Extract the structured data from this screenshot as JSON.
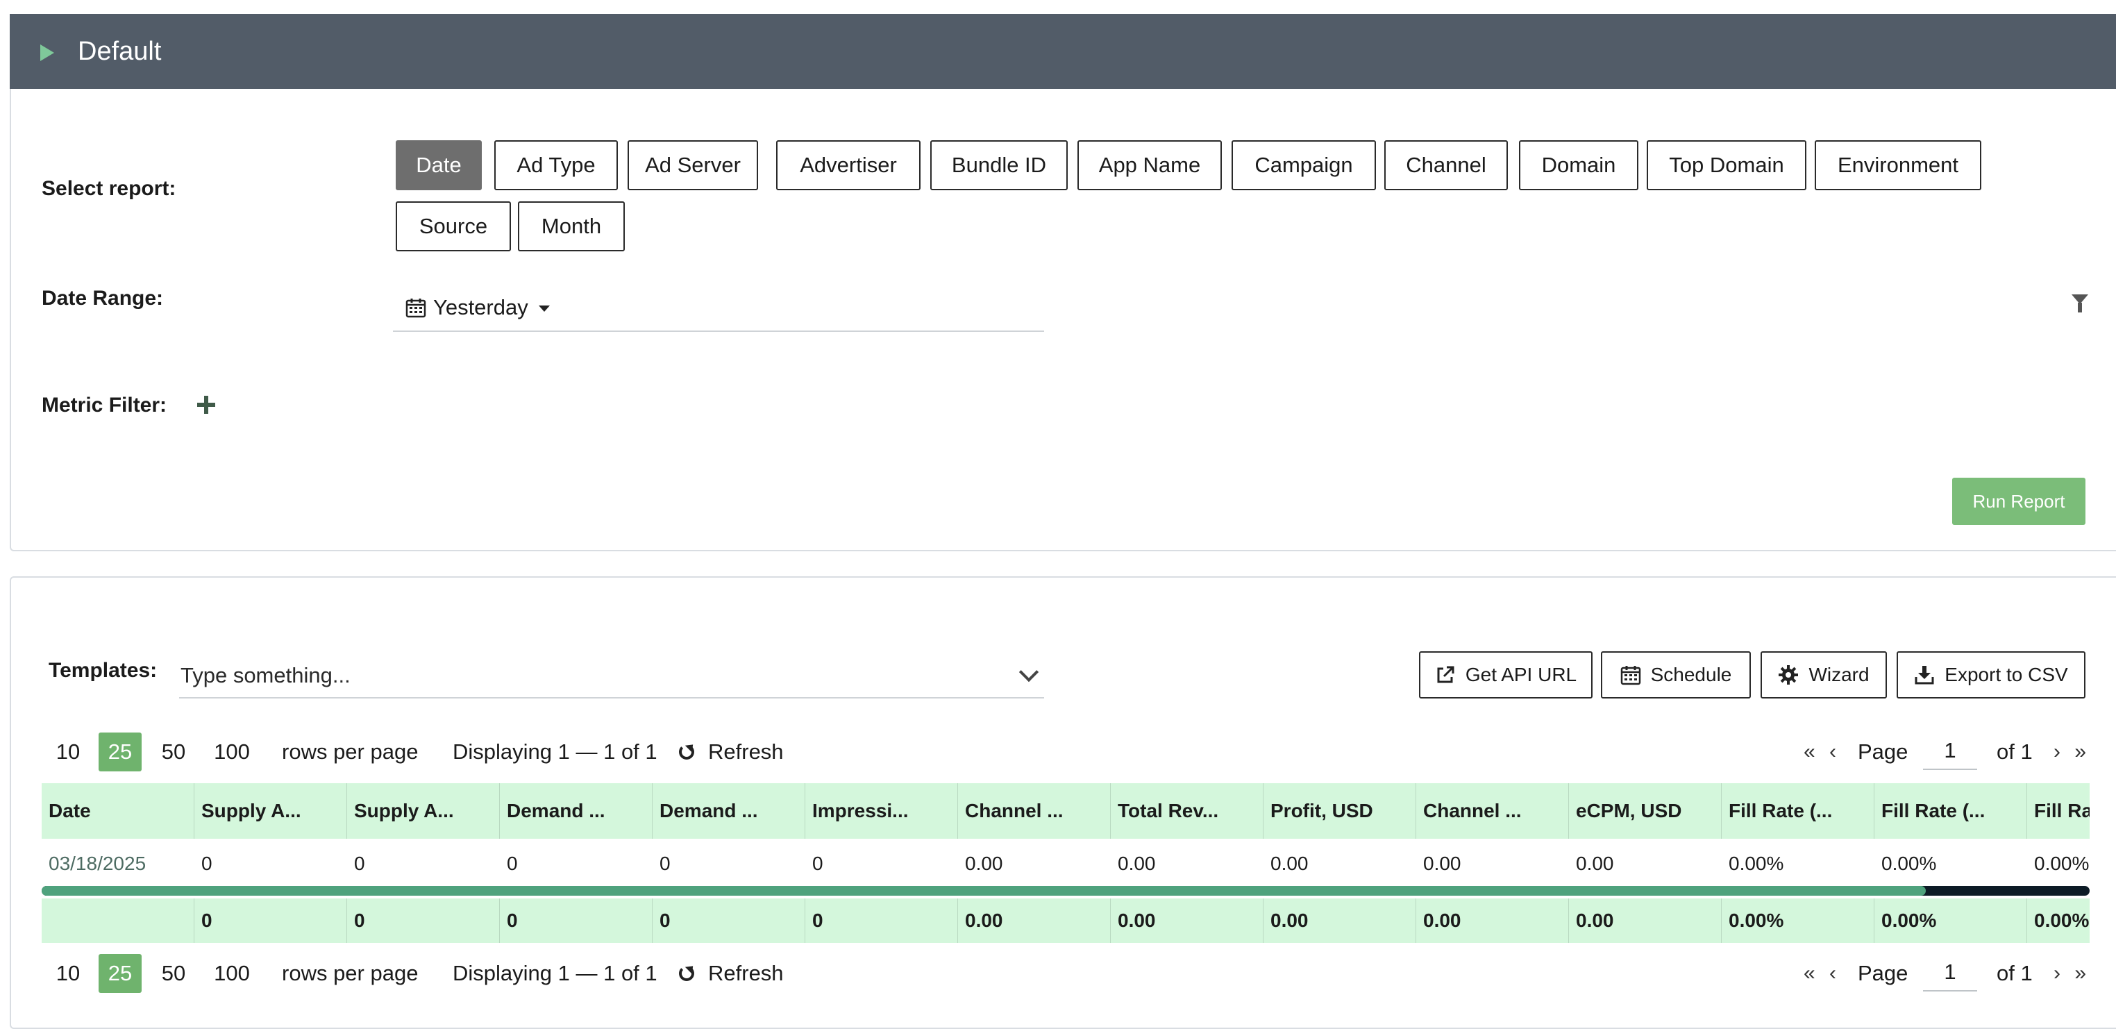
{
  "header": {
    "title": "Default"
  },
  "report": {
    "select_label": "Select report:",
    "buttons": [
      "Date",
      "Ad Type",
      "Ad Server",
      "Advertiser",
      "Bundle ID",
      "App Name",
      "Campaign",
      "Channel",
      "Domain",
      "Top Domain",
      "Environment",
      "Source",
      "Month"
    ],
    "active": "Date"
  },
  "date_range": {
    "label": "Date Range:",
    "value": "Yesterday"
  },
  "metric_filter": {
    "label": "Metric Filter:"
  },
  "run_button": "Run Report",
  "templates": {
    "label": "Templates:",
    "placeholder": "Type something..."
  },
  "actions": {
    "api": "Get API URL",
    "schedule": "Schedule",
    "wizard": "Wizard",
    "export": "Export to CSV"
  },
  "pager": {
    "sizes": [
      "10",
      "25",
      "50",
      "100"
    ],
    "active_size": "25",
    "rows_per_page": "rows per page",
    "displaying": "Displaying 1 — 1 of 1",
    "refresh": "Refresh",
    "first_prev": "« ‹",
    "page_label": "Page",
    "page_value": "1",
    "of_label": "of 1",
    "next_last": "› »"
  },
  "table": {
    "columns": [
      "Date",
      "Supply A...",
      "Supply A...",
      "Demand ...",
      "Demand ...",
      "Impressi...",
      "Channel ...",
      "Total Rev...",
      "Profit, USD",
      "Channel ...",
      "eCPM, USD",
      "Fill Rate (...",
      "Fill Rate (...",
      "Fill Ra"
    ],
    "rows": [
      [
        "03/18/2025",
        "0",
        "0",
        "0",
        "0",
        "0",
        "0.00",
        "0.00",
        "0.00",
        "0.00",
        "0.00",
        "0.00%",
        "0.00%",
        "0.00%"
      ]
    ],
    "totals": [
      "",
      "0",
      "0",
      "0",
      "0",
      "0",
      "0.00",
      "0.00",
      "0.00",
      "0.00",
      "0.00",
      "0.00%",
      "0.00%",
      "0.00%"
    ],
    "scroll_fraction": 0.92
  }
}
